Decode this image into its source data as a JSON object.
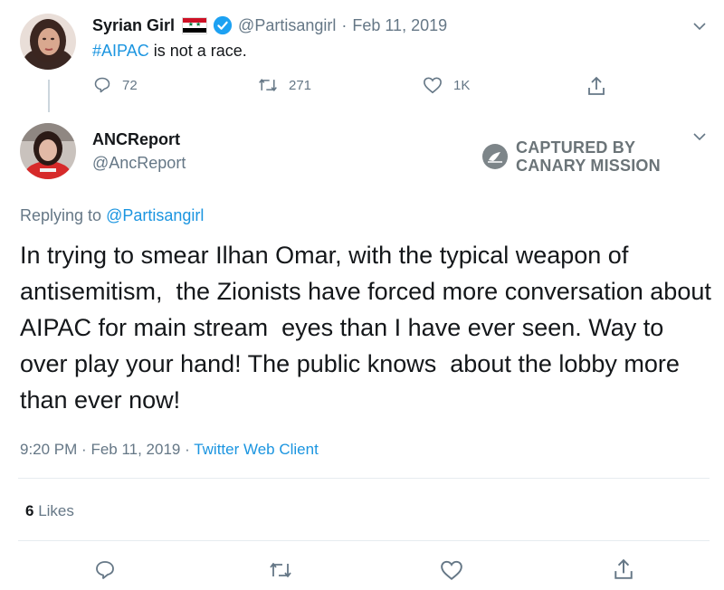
{
  "parent_tweet": {
    "name": "Syrian Girl",
    "flag": "🇸🇾",
    "handle": "@Partisangirl",
    "date": "Feb 11, 2019",
    "hashtag": "#AIPAC",
    "text_rest": " is not a race.",
    "replies": "72",
    "retweets": "271",
    "likes": "1K"
  },
  "main_tweet": {
    "name": "ANCReport",
    "handle": "@AncReport",
    "replying_prefix": "Replying to ",
    "replying_handle": "@Partisangirl",
    "body": "In trying to smear Ilhan Omar, with the typical weapon of antisemitism,  the Zionists have forced more conversation about AIPAC for main stream  eyes than I have ever seen. Way to over play your hand! The public knows  about the lobby more than ever now!",
    "time": "9:20 PM",
    "date": "Feb 11, 2019",
    "source": "Twitter Web Client",
    "likes_count": "6",
    "likes_label": "Likes"
  },
  "watermark": {
    "line1": "CAPTURED BY",
    "line2": "CANARY MISSION"
  },
  "colors": {
    "link": "#1b95e0",
    "verified": "#1da1f2",
    "muted": "#657786",
    "divider": "#e6ecf0"
  },
  "icons": [
    "chevron-down-icon",
    "reply-icon",
    "retweet-icon",
    "like-icon",
    "share-icon",
    "verified-badge-icon",
    "canary-logo-icon"
  ]
}
